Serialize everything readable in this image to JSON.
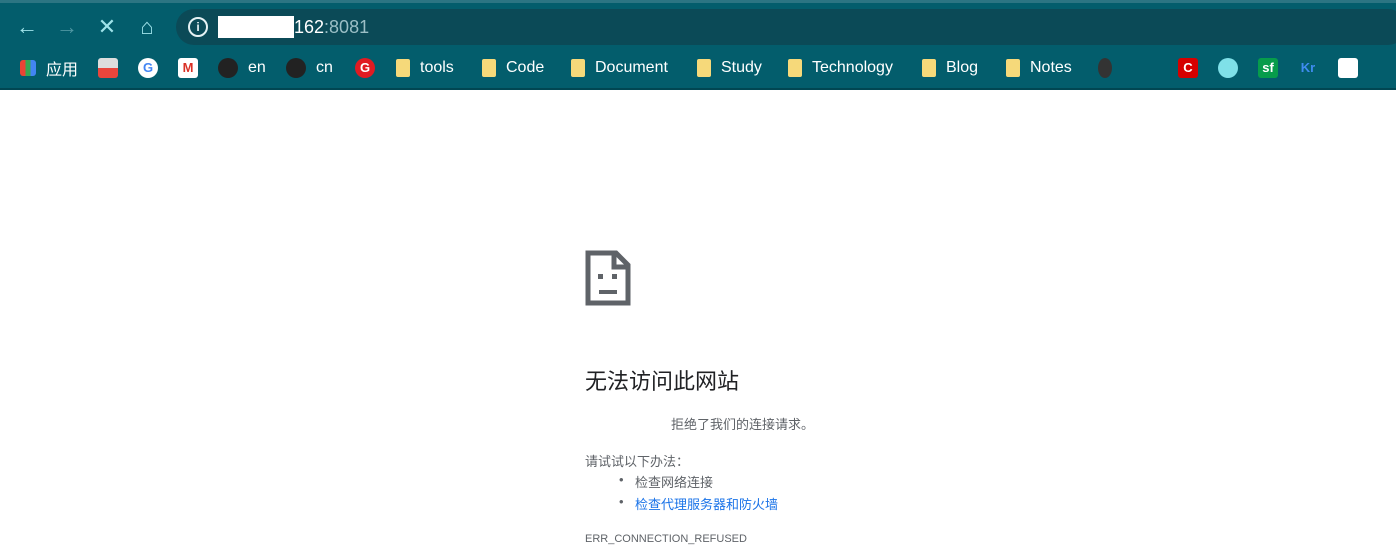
{
  "browser": {
    "address_host_visible": "162",
    "address_port": ":8081",
    "nav": {
      "back": "back-icon",
      "forward": "forward-icon",
      "stop": "close-icon",
      "home": "home-icon"
    }
  },
  "bookmarks": [
    {
      "label": "应用",
      "icon": "apps-grid-icon"
    },
    {
      "label": "",
      "icon": "chrome-web-store-icon"
    },
    {
      "label": "",
      "icon": "google-icon"
    },
    {
      "label": "",
      "icon": "gmail-icon"
    },
    {
      "label": "en",
      "icon": "github-icon"
    },
    {
      "label": "cn",
      "icon": "github-icon"
    },
    {
      "label": "",
      "icon": "red-g-icon"
    },
    {
      "label": "tools",
      "icon": "folder-icon"
    },
    {
      "label": "Code",
      "icon": "folder-icon"
    },
    {
      "label": "Document",
      "icon": "folder-icon"
    },
    {
      "label": "Study",
      "icon": "folder-icon"
    },
    {
      "label": "Technology",
      "icon": "folder-icon"
    },
    {
      "label": "Blog",
      "icon": "folder-icon"
    },
    {
      "label": "Notes",
      "icon": "folder-icon"
    }
  ],
  "extra_icons": [
    {
      "icon": "avatar-icon",
      "text": ""
    },
    {
      "icon": "swoosh-icon",
      "text": ""
    },
    {
      "icon": "csdn-icon",
      "text": "C"
    },
    {
      "icon": "globe-icon",
      "text": ""
    },
    {
      "icon": "segmentfault-icon",
      "text": "sf"
    },
    {
      "icon": "36kr-icon",
      "text": "Kr"
    },
    {
      "icon": "arrow-box-icon",
      "text": ""
    },
    {
      "icon": "misc-icon",
      "text": ""
    }
  ],
  "error": {
    "icon": "sad-page-icon",
    "title": "无法访问此网站",
    "message": "拒绝了我们的连接请求。",
    "suggest_heading": "请试试以下办法：",
    "suggestions": [
      "检查网络连接",
      "检查代理服务器和防火墙"
    ],
    "code": "ERR_CONNECTION_REFUSED"
  }
}
